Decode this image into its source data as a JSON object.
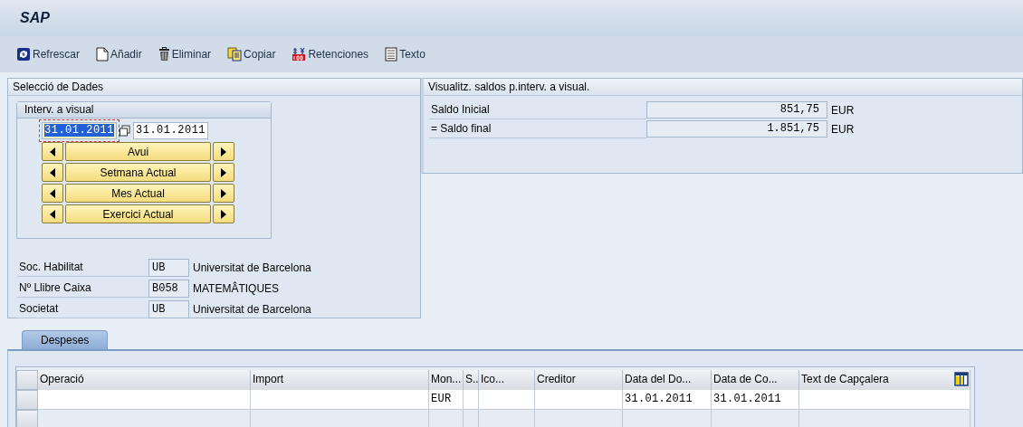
{
  "window": {
    "title": "SAP"
  },
  "toolbar": [
    {
      "kind": "refresh",
      "label": "Refrescar"
    },
    {
      "kind": "add",
      "label": "Añadir"
    },
    {
      "kind": "delete",
      "label": "Eliminar"
    },
    {
      "kind": "copy",
      "label": "Copiar"
    },
    {
      "kind": "retentions",
      "label": "Retenciones"
    },
    {
      "kind": "text",
      "label": "Texto"
    }
  ],
  "selection_panel": {
    "title": "Selecció de Dades",
    "interval": {
      "title": "Interv. a visual",
      "date_from": {
        "value": "31.01.2011",
        "focused": true
      },
      "date_to": {
        "value": "31.01.2011"
      },
      "periods": [
        "Avui",
        "Setmana Actual",
        "Mes Actual",
        "Exercici Actual"
      ]
    },
    "fields": [
      {
        "label": "Soc. Habilitat",
        "code": "UB",
        "description": "Universitat de Barcelona"
      },
      {
        "label": "Nº Llibre Caixa",
        "code": "B058",
        "description": "MATEMÂTIQUES"
      },
      {
        "label": "Societat",
        "code": "UB",
        "description": "Universitat de Barcelona"
      }
    ]
  },
  "balance_panel": {
    "title": "Visualitz. saldos p.interv. a visual.",
    "rows": [
      {
        "label": "Saldo Inicial",
        "value": "851,75",
        "currency": "EUR"
      },
      {
        "label": "= Saldo final",
        "value": "1.851,75",
        "currency": "EUR"
      }
    ]
  },
  "tabs": [
    {
      "label": "Despeses",
      "selected": true
    }
  ],
  "table": {
    "columns": [
      "Operació",
      "Import",
      "Mon...",
      "S..",
      "Ico...",
      "Creditor",
      "Data del Do...",
      "Data de Co...",
      "Text de Capçalera"
    ],
    "rows": [
      {
        "cells": [
          null,
          null,
          "EUR",
          null,
          null,
          null,
          "31.01.2011",
          "31.01.2011",
          null
        ]
      }
    ]
  }
}
